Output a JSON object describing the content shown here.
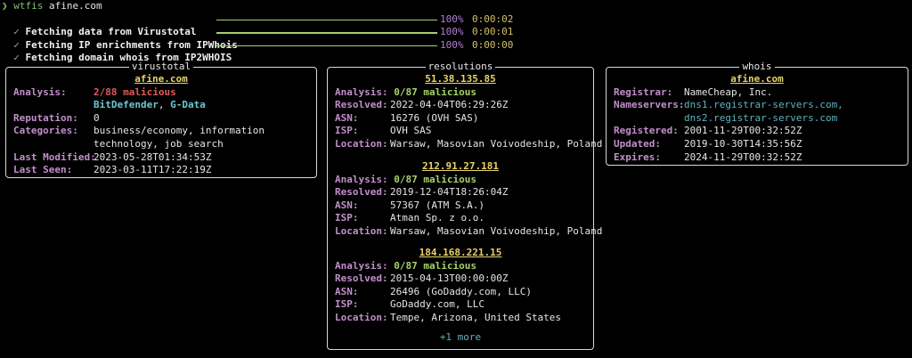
{
  "prompt": {
    "arrow": "❯",
    "command": "wtfis",
    "argument": "afine.com"
  },
  "progress": [
    {
      "check": "✓",
      "label": "Fetching data from Virustotal",
      "percent": "100%",
      "time": "0:00:02"
    },
    {
      "check": "✓",
      "label": "Fetching IP enrichments from IPWhois",
      "percent": "100%",
      "time": "0:00:01"
    },
    {
      "check": "✓",
      "label": "Fetching domain whois from IP2WHOIS",
      "percent": "100%",
      "time": "0:00:00"
    }
  ],
  "virustotal": {
    "title": "virustotal",
    "domain": "afine.com",
    "analysis_key": "Analysis:",
    "analysis_value": "2/88 malicious",
    "engines": [
      "BitDefender",
      "G-Data"
    ],
    "engine_sep": ", ",
    "reputation_key": "Reputation:",
    "reputation_value": "0",
    "categories_key": "Categories:",
    "categories_lines": [
      "business/economy, information",
      "technology, job search"
    ],
    "last_modified_key": "Last Modified:",
    "last_modified_value": "2023-05-28T01:34:53Z",
    "last_seen_key": "Last Seen:",
    "last_seen_value": "2023-03-11T17:22:19Z"
  },
  "resolutions": {
    "title": "resolutions",
    "labels": {
      "analysis": "Analysis:",
      "resolved": "Resolved:",
      "asn": "ASN:",
      "isp": "ISP:",
      "location": "Location:"
    },
    "items": [
      {
        "ip": "51.38.135.85",
        "analysis": "0/87 malicious",
        "resolved": "2022-04-04T06:29:26Z",
        "asn": "16276 (OVH SAS)",
        "isp": "OVH SAS",
        "location": "Warsaw, Masovian Voivodeship, Poland"
      },
      {
        "ip": "212.91.27.181",
        "analysis": "0/87 malicious",
        "resolved": "2019-12-04T18:26:04Z",
        "asn": "57367 (ATM S.A.)",
        "isp": "Atman Sp. z o.o.",
        "location": "Warsaw, Masovian Voivodeship, Poland"
      },
      {
        "ip": "184.168.221.15",
        "analysis": "0/87 malicious",
        "resolved": "2015-04-13T00:00:00Z",
        "asn": "26496 (GoDaddy.com, LLC)",
        "isp": "GoDaddy.com, LLC",
        "location": "Tempe, Arizona, United States"
      }
    ],
    "more": "+1 more"
  },
  "whois": {
    "title": "whois",
    "domain": "afine.com",
    "registrar_key": "Registrar:",
    "registrar_value": "NameCheap, Inc.",
    "nameservers_key": "Nameservers:",
    "nameservers": [
      "dns1.registrar-servers.com,",
      "dns2.registrar-servers.com"
    ],
    "registered_key": "Registered:",
    "registered_value": "2001-11-29T00:32:52Z",
    "updated_key": "Updated:",
    "updated_value": "2019-10-30T14:35:56Z",
    "expires_key": "Expires:",
    "expires_value": "2024-11-29T00:32:52Z"
  },
  "colors": {
    "background": "#000000",
    "key": "#c28fcb",
    "malicious": "#e05a5a",
    "clean": "#a7d36a",
    "engine": "#6cc8d4",
    "header": "#e8d36a",
    "bar": "#a6d26b"
  }
}
